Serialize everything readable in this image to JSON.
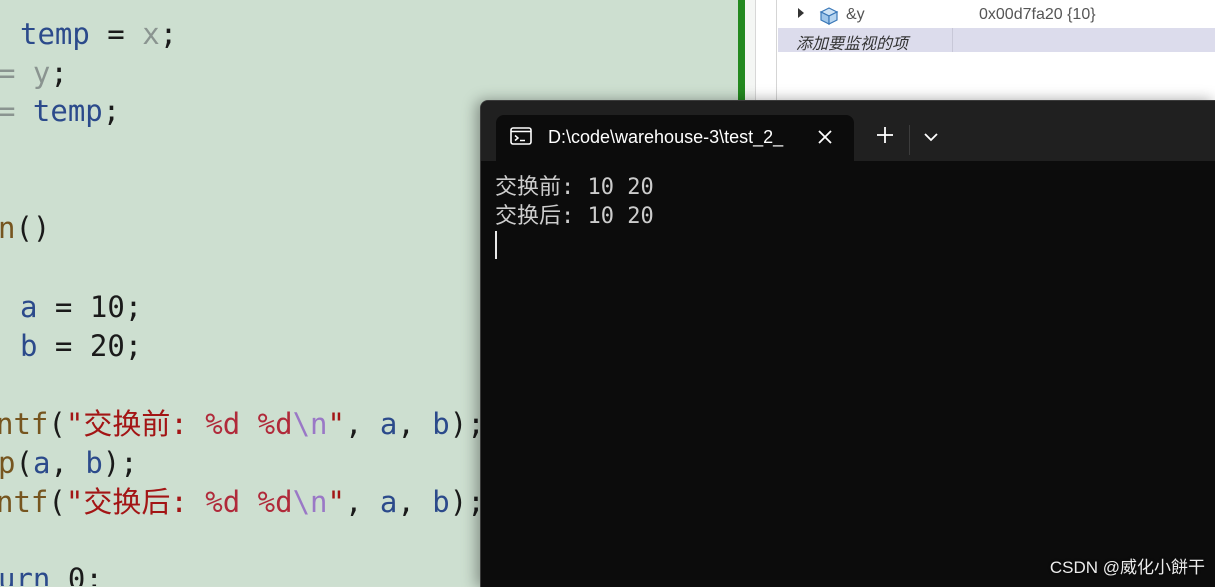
{
  "editor": {
    "lines": [
      {
        "parts": [
          "temp",
          " = ",
          "x",
          ";"
        ]
      },
      {
        "parts": [
          "= ",
          "y",
          ";"
        ]
      },
      {
        "parts": [
          "= ",
          "temp",
          ";"
        ]
      },
      {
        "parts": [
          "n",
          "()"
        ]
      },
      {
        "parts": [
          "a",
          " = ",
          "10",
          ";"
        ]
      },
      {
        "parts": [
          "b",
          " = ",
          "20",
          ";"
        ]
      },
      {
        "parts": [
          "ntf",
          "(",
          "\"交换前: ",
          "%d",
          " ",
          "%d",
          "\\n",
          "\"",
          ", ",
          "a",
          ", ",
          "b",
          ");"
        ]
      },
      {
        "parts": [
          "p",
          "(",
          "a",
          ", ",
          "b",
          ");"
        ]
      },
      {
        "parts": [
          "ntf",
          "(",
          "\"交换后: ",
          "%d",
          " ",
          "%d",
          "\\n",
          "\"",
          ", ",
          "a",
          ", ",
          "b",
          ");"
        ]
      },
      {
        "parts": [
          "urn",
          " ",
          "0",
          ";"
        ]
      }
    ]
  },
  "watch": {
    "rows": [
      {
        "name": "&y",
        "value": "0x00d7fa20 {10}",
        "icon": "variable-cube-icon"
      }
    ],
    "add_item_label": "添加要监视的项"
  },
  "terminal": {
    "tab_title": "D:\\code\\warehouse-3\\test_2_",
    "tab_icon": "console-icon",
    "new_tab_icon": "plus-icon",
    "dropdown_icon": "chevron-down-icon",
    "close_icon": "close-icon",
    "output": [
      "交换前: 10 20",
      "交换后: 10 20"
    ]
  },
  "watermark": "CSDN @威化小餅干",
  "colors": {
    "editor_bg": "#cddfd0",
    "terminal_bg": "#0c0c0c",
    "titlebar_bg": "#202020",
    "splitter_green": "#23891f",
    "string": "#a31515",
    "identifier": "#2b4a8b",
    "function": "#76551f"
  }
}
